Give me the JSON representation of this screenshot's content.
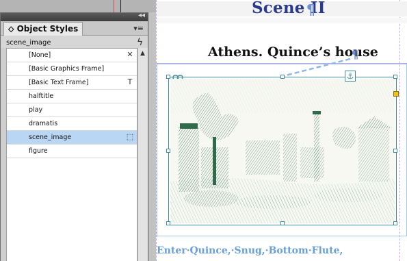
{
  "panel": {
    "tab_label": "Object Styles",
    "collapse_glyph": "◂◂",
    "menu_glyph": "▾≡",
    "current_style": "scene_image",
    "quick_apply_icon": "lightning-icon",
    "styles": [
      {
        "label": "[None]",
        "icon": "✕",
        "icon_name": "clear-overrides-icon"
      },
      {
        "label": "[Basic Graphics Frame]",
        "icon": "",
        "icon_name": ""
      },
      {
        "label": "[Basic Text Frame]",
        "icon": "T",
        "icon_name": "text-frame-icon"
      },
      {
        "label": "halftitle",
        "icon": "",
        "icon_name": ""
      },
      {
        "label": "play",
        "icon": "",
        "icon_name": ""
      },
      {
        "label": "dramatis",
        "icon": "",
        "icon_name": ""
      },
      {
        "label": "scene_image",
        "icon": "⬚",
        "icon_name": "graphic-frame-icon"
      },
      {
        "label": "figure",
        "icon": "",
        "icon_name": ""
      }
    ],
    "selected_index": 6,
    "scroll_up_glyph": "▲"
  },
  "document": {
    "scene_heading": "Scene II",
    "place_heading": "Athens. Quince’s house",
    "pilcrow": "¶",
    "stage_direction": "Enter·Quince,·Snug,·Bottom·Flute,",
    "anchor_glyph": "⚓"
  },
  "colors": {
    "scene_heading": "#2b3a8a",
    "frame_edge": "#3d8aa2",
    "selection_row": "#b9d6f5",
    "stage_direction": "#6aa0d8"
  }
}
